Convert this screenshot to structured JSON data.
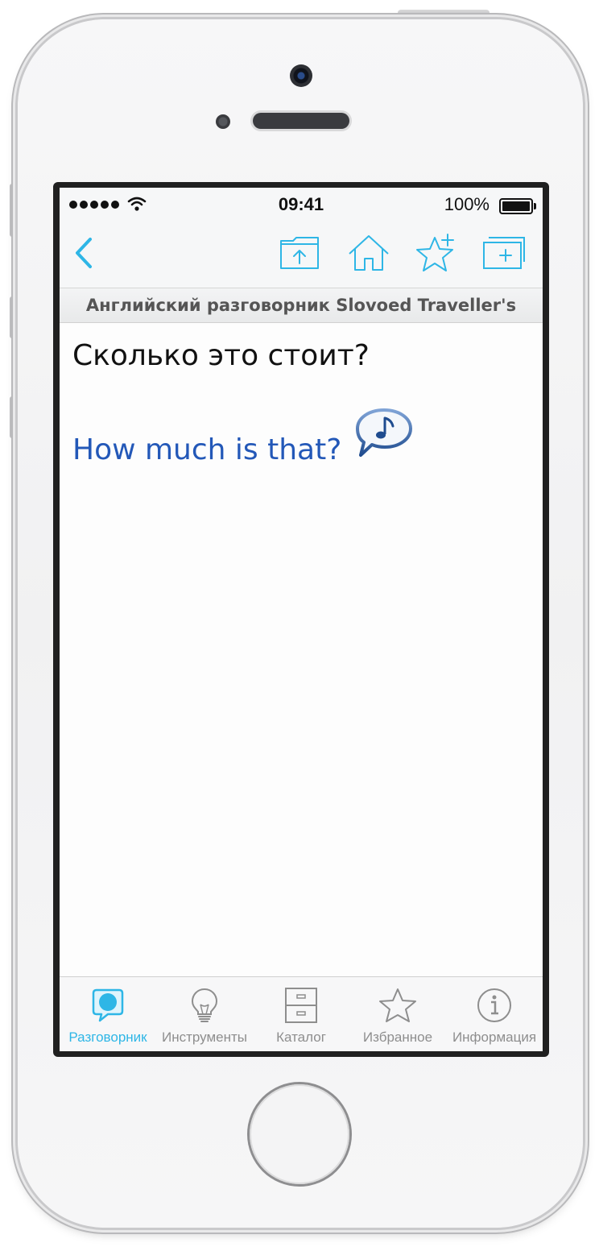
{
  "status_bar": {
    "time": "09:41",
    "battery": "100%"
  },
  "navbar": {
    "buttons": [
      {
        "icon": "back-chevron-icon"
      },
      {
        "icon": "folder-upload-icon"
      },
      {
        "icon": "home-icon"
      },
      {
        "icon": "star-add-icon"
      },
      {
        "icon": "new-tab-icon"
      }
    ],
    "accent_color": "#2eb6e6"
  },
  "dictionary_title": "Английский разговорник Slovoed Traveller's",
  "entry": {
    "phrase": "Сколько это стоит?",
    "translation": "How much is that?",
    "sound_icon": "speech-bubble-note-icon"
  },
  "tabbar": {
    "active_color": "#2eb6e6",
    "inactive_color": "#8e8e8e",
    "tabs": [
      {
        "label": "Разговорник",
        "icon": "speech-bubble-icon",
        "active": true
      },
      {
        "label": "Инструменты",
        "icon": "lightbulb-icon",
        "active": false
      },
      {
        "label": "Каталог",
        "icon": "drawer-icon",
        "active": false
      },
      {
        "label": "Избранное",
        "icon": "star-icon",
        "active": false
      },
      {
        "label": "Информация",
        "icon": "info-icon",
        "active": false
      }
    ]
  }
}
